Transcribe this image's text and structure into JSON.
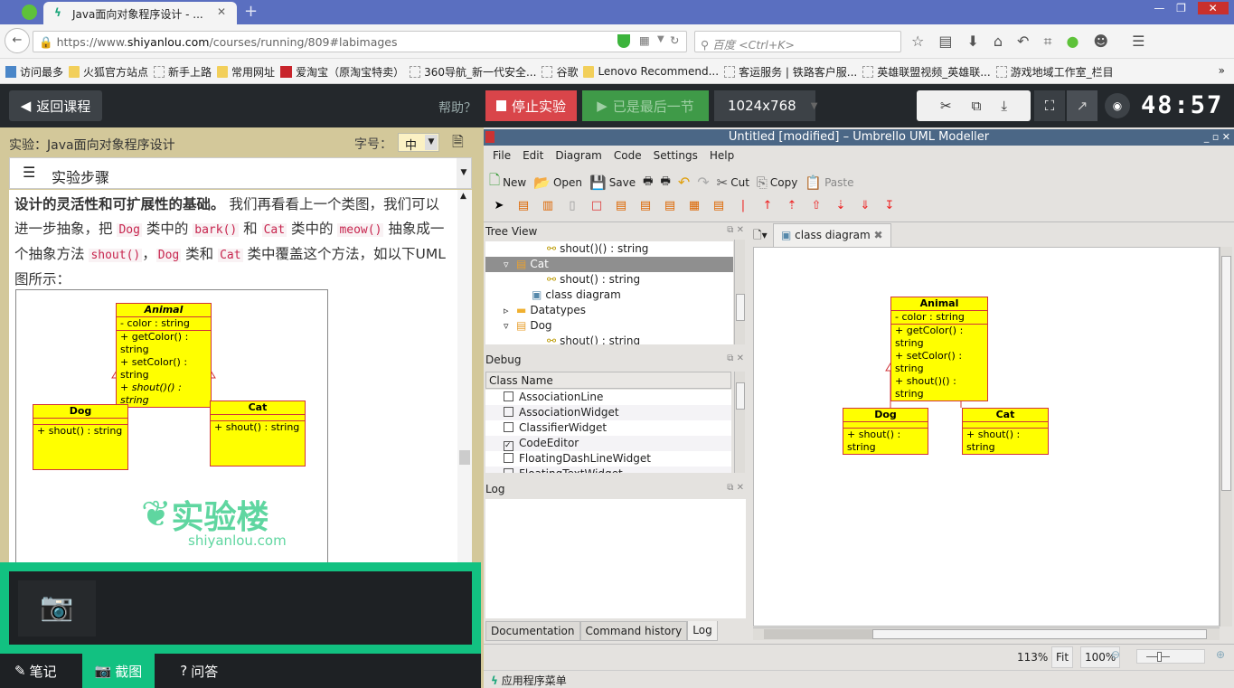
{
  "browser": {
    "tab_title": "Java面向对象程序设计 - ...",
    "new_tab": "+",
    "url_prefix": "https://www.",
    "url_domain": "shiyanlou.com",
    "url_path": "/courses/running/809#labimages",
    "search_placeholder": "百度 <Ctrl+K>",
    "bookmarks": [
      {
        "label": "访问最多",
        "icon": "most-visited-icon"
      },
      {
        "label": "火狐官方站点",
        "icon": "folder-icon"
      },
      {
        "label": "新手上路",
        "icon": "page-icon"
      },
      {
        "label": "常用网址",
        "icon": "folder-icon"
      },
      {
        "label": "爱淘宝（原淘宝特卖）",
        "icon": "taobao-icon"
      },
      {
        "label": "360导航_新一代安全...",
        "icon": "page-icon"
      },
      {
        "label": "谷歌",
        "icon": "page-icon"
      },
      {
        "label": "Lenovo Recommend...",
        "icon": "folder-icon"
      },
      {
        "label": "客运服务 | 铁路客户服...",
        "icon": "page-icon"
      },
      {
        "label": "英雄联盟视频_英雄联...",
        "icon": "page-icon"
      },
      {
        "label": "游戏地域工作室_栏目",
        "icon": "page-icon"
      }
    ],
    "overflow": "»"
  },
  "labbar": {
    "back": "返回课程",
    "help": "帮助？",
    "stop": "停止实验",
    "last": "已是最后一节",
    "resolution": "1024x768",
    "timer": "48:57",
    "colors": {
      "stop": "#d9454a",
      "last": "#3f9a48",
      "timer": "#ffffff"
    }
  },
  "left": {
    "lab_title": "实验：Java面向对象程序设计",
    "font_label": "字号：",
    "font_value": "中",
    "steps_label": "实验步骤",
    "para": {
      "bold": "设计的灵活性和可扩展性的基础。",
      "t1": " 我们再看看上一个类图，我们可以进一步抽象，把 ",
      "c1": "Dog",
      "t2": " 类中的 ",
      "c2": "bark()",
      "t3": " 和 ",
      "c4": "Cat",
      "t4": " 类中的 ",
      "c5": "meow()",
      "t5": " 抽象成一个抽象方法 ",
      "c6": "shout()",
      "t6": "，",
      "c7": "Dog",
      "t7": " 类和 ",
      "c8": "Cat",
      "t8": " 类中覆盖这个方法，如以下UML图所示："
    },
    "watermark": "实验楼",
    "watermark_url": "shiyanlou.com",
    "bottom_tabs": [
      {
        "label": "笔记",
        "icon": "pencil-icon"
      },
      {
        "label": "截图",
        "icon": "camera-icon",
        "active": true
      },
      {
        "label": "问答",
        "icon": "question-icon"
      }
    ],
    "accent": "#12c181"
  },
  "app": {
    "title": "Untitled [modified] – Umbrello UML Modeller",
    "menu": [
      "File",
      "Edit",
      "Diagram",
      "Code",
      "Settings",
      "Help"
    ],
    "toolbar": [
      "New",
      "Open",
      "Save",
      "Cut",
      "Copy",
      "Paste"
    ],
    "tree_title": "Tree View",
    "tree": [
      {
        "label": "shout()() : string",
        "indent": 4,
        "icon": "operation-icon"
      },
      {
        "label": "Cat",
        "indent": 2,
        "icon": "class-icon",
        "selected": true,
        "expanded": true
      },
      {
        "label": "shout() : string",
        "indent": 4,
        "icon": "operation-icon"
      },
      {
        "label": "class diagram",
        "indent": 3,
        "icon": "diagram-icon"
      },
      {
        "label": "Datatypes",
        "indent": 2,
        "icon": "folder-icon",
        "collapsed": true
      },
      {
        "label": "Dog",
        "indent": 2,
        "icon": "class-icon",
        "expanded": true
      },
      {
        "label": "shout() : string",
        "indent": 4,
        "icon": "operation-icon"
      }
    ],
    "debug_title": "Debug",
    "debug_header": "Class Name",
    "debug": [
      {
        "label": "AssociationLine",
        "checked": false
      },
      {
        "label": "AssociationWidget",
        "checked": false
      },
      {
        "label": "ClassifierWidget",
        "checked": false
      },
      {
        "label": "CodeEditor",
        "checked": true
      },
      {
        "label": "FloatingDashLineWidget",
        "checked": false
      },
      {
        "label": "FloatingTextWidget",
        "checked": false
      }
    ],
    "log_title": "Log",
    "dock_tabs": [
      "Documentation",
      "Command history",
      "Log"
    ],
    "diagram_tab": "class diagram",
    "zoom": "113%",
    "fit": "Fit",
    "hundred": "100%",
    "taskbar": "应用程序菜单"
  },
  "uml": {
    "classes": [
      {
        "name": "Animal",
        "attributes": [
          "- color : string"
        ],
        "operations": [
          "+ getColor() : string",
          "+ setColor() : string",
          "+ shout()() : string"
        ]
      },
      {
        "name": "Dog",
        "attributes": [],
        "operations": [
          "+ shout() : string"
        ]
      },
      {
        "name": "Cat",
        "attributes": [],
        "operations": [
          "+ shout() : string"
        ]
      }
    ],
    "fill": "#ffff00",
    "border": "#d0343a"
  }
}
